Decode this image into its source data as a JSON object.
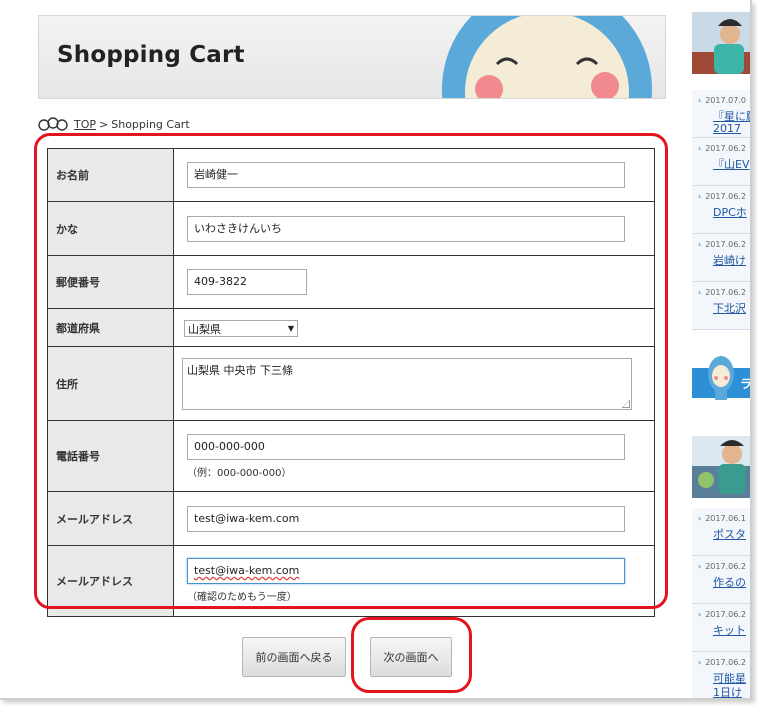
{
  "header": {
    "title": "Shopping Cart"
  },
  "breadcrumb": {
    "top_label": "TOP",
    "separator": ">",
    "current": "Shopping Cart"
  },
  "form": {
    "rows": {
      "name": {
        "label": "お名前",
        "value": "岩崎健一"
      },
      "kana": {
        "label": "かな",
        "value": "いわさきけんいち"
      },
      "postal": {
        "label": "郵便番号",
        "value": "409-3822"
      },
      "prefecture": {
        "label": "都道府県",
        "selected": "山梨県"
      },
      "address": {
        "label": "住所",
        "value": "山梨県 中央市 下三條"
      },
      "phone": {
        "label": "電話番号",
        "value": "000-000-000",
        "hint": "（例：000-000-000）"
      },
      "email": {
        "label": "メールアドレス",
        "value": "test@iwa-kem.com"
      },
      "email_confirm": {
        "label": "メールアドレス",
        "value": "test@iwa-kem.com",
        "hint": "（確認のためもう一度）"
      }
    }
  },
  "buttons": {
    "back": "前の画面へ戻る",
    "next": "次の画面へ"
  },
  "sidebar": {
    "items_top": [
      {
        "date": "2017.07.0",
        "title": "『星に願",
        "title2": "2017"
      },
      {
        "date": "2017.06.2",
        "title": "『山EV"
      },
      {
        "date": "2017.06.2",
        "title": "DPCホ"
      },
      {
        "date": "2017.06.2",
        "title": "岩崎け"
      },
      {
        "date": "2017.06.2",
        "title": "下北沢"
      }
    ],
    "banner_label": "ラ",
    "items_bottom": [
      {
        "date": "2017.06.1",
        "title": "ポスタ"
      },
      {
        "date": "2017.06.2",
        "title": "作るの"
      },
      {
        "date": "2017.06.2",
        "title": "キット"
      },
      {
        "date": "2017.06.2",
        "title": "可能星",
        "title2": "1日け"
      }
    ]
  },
  "colors": {
    "annotation_red": "#e3141d",
    "sidebar_blue": "#2d8fd6",
    "link_blue": "#1f57a6"
  }
}
